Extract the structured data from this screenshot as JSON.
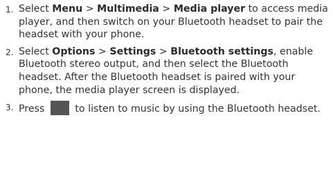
{
  "steps": [
    {
      "number": "1.",
      "parts": [
        {
          "t": "Select ",
          "b": false
        },
        {
          "t": "Menu",
          "b": true
        },
        {
          "t": " > ",
          "b": false
        },
        {
          "t": "Multimedia",
          "b": true
        },
        {
          "t": " > ",
          "b": false
        },
        {
          "t": "Media player",
          "b": true
        },
        {
          "t": " to access media player, and then switch on your Bluetooth headset to pair the headset with your phone.",
          "b": false
        }
      ]
    },
    {
      "number": "2.",
      "parts": [
        {
          "t": "Select ",
          "b": false
        },
        {
          "t": "Options",
          "b": true
        },
        {
          "t": " > ",
          "b": false
        },
        {
          "t": "Settings",
          "b": true
        },
        {
          "t": " > ",
          "b": false
        },
        {
          "t": "Bluetooth settings",
          "b": true
        },
        {
          "t": ", enable Bluetooth stereo output, and then select the Bluetooth headset. After the Bluetooth headset is paired with your phone, the media player screen is displayed.",
          "b": false
        }
      ]
    },
    {
      "number": "3.",
      "parts": [
        {
          "t": "Press ",
          "b": false
        },
        {
          "icon": "play-key-icon"
        },
        {
          "t": " to listen to music by using the Bluetooth headset.",
          "b": false
        }
      ]
    }
  ]
}
